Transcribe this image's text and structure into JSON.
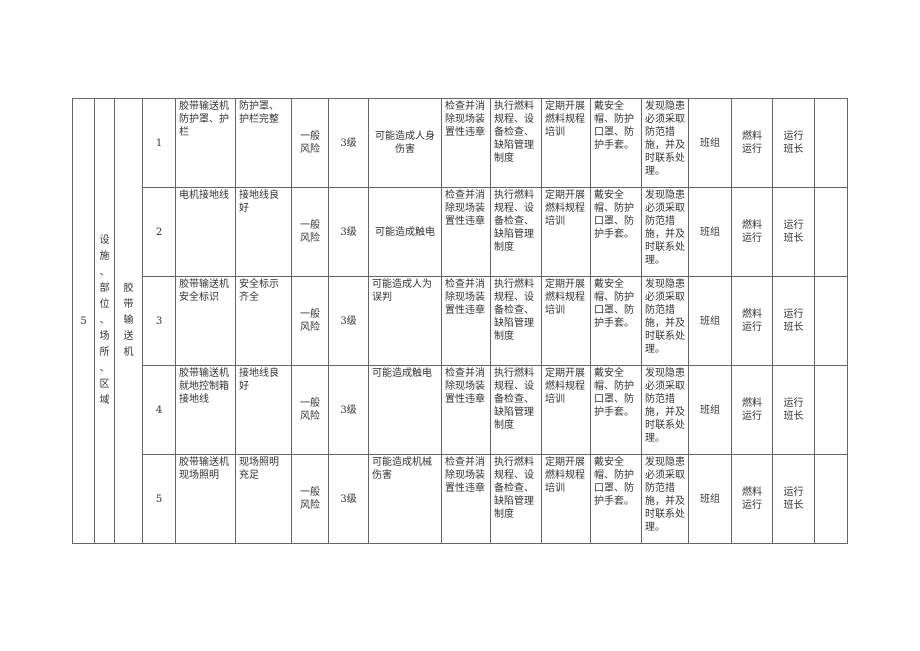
{
  "group": {
    "number": "5",
    "category": "设施、部位、场所、区域",
    "category_chars": [
      "设",
      "施",
      "、",
      "部",
      "位",
      "、",
      "场",
      "所",
      "、",
      "区",
      "域"
    ],
    "equipment": "胶带输送机",
    "equipment_chars": [
      "胶",
      "带",
      "输",
      "送",
      "机"
    ]
  },
  "rows": [
    {
      "index": "1",
      "check_item": "胶带输送机防护罩、护栏",
      "standard": "防护罩、护栏完整",
      "risk_type": "一般风险",
      "level": "3级",
      "consequence": "可能造成人身伤害",
      "engineering": "检查并消除现场装置性违章",
      "management": "执行燃料规程、设备检查、缺陷管理制度",
      "training": "定期开展燃料规程培训",
      "protection": "戴安全帽、防护口罩、防护手套。",
      "emergency": "发现隐患必须采取防范措施，并及时联系处理。",
      "level_unit": "班组",
      "department": "燃料运行",
      "responsible": "运行班长",
      "remark": ""
    },
    {
      "index": "2",
      "check_item": "电机接地线",
      "standard": "接地线良好",
      "risk_type": "一般风险",
      "level": "3级",
      "consequence": "可能造成触电",
      "engineering": "检查并消除现场装置性违章",
      "management": "执行燃料规程、设备检查、缺陷管理制度",
      "training": "定期开展燃料规程培训",
      "protection": "戴安全帽、防护口罩、防护手套。",
      "emergency": "发现隐患必须采取防范措施，并及时联系处理。",
      "level_unit": "班组",
      "department": "燃料运行",
      "responsible": "运行班长",
      "remark": ""
    },
    {
      "index": "3",
      "check_item": "胶带输送机安全标识",
      "standard": "安全标示齐全",
      "risk_type": "一般风险",
      "level": "3级",
      "consequence": "可能造成人为误判",
      "engineering": "检查并消除现场装置性违章",
      "management": "执行燃料规程、设备检查、缺陷管理制度",
      "training": "定期开展燃料规程培训",
      "protection": "戴安全帽、防护口罩、防护手套。",
      "emergency": "发现隐患必须采取防范措施，并及时联系处理。",
      "level_unit": "班组",
      "department": "燃料运行",
      "responsible": "运行班长",
      "remark": ""
    },
    {
      "index": "4",
      "check_item": "胶带输送机就地控制箱接地线",
      "standard": "接地线良好",
      "risk_type": "一般风险",
      "level": "3级",
      "consequence": "可能造成触电",
      "engineering": "检查并消除现场装置性违章",
      "management": "执行燃料规程、设备检查、缺陷管理制度",
      "training": "定期开展燃料规程培训",
      "protection": "戴安全帽、防护口罩、防护手套。",
      "emergency": "发现隐患必须采取防范措施，并及时联系处理。",
      "level_unit": "班组",
      "department": "燃料运行",
      "responsible": "运行班长",
      "remark": ""
    },
    {
      "index": "5",
      "check_item": "胶带输送机现场照明",
      "standard": "现场照明充足",
      "risk_type": "一般风险",
      "level": "3级",
      "consequence": "可能造成机械伤害",
      "engineering": "检查并消除现场装置性违章",
      "management": "执行燃料规程、设备检查、缺陷管理制度",
      "training": "定期开展燃料规程培训",
      "protection": "戴安全帽、防护口罩、防护手套。",
      "emergency": "发现隐患必须采取防范措施，并及时联系处理。",
      "level_unit": "班组",
      "department": "燃料运行",
      "responsible": "运行班长",
      "remark": ""
    }
  ]
}
